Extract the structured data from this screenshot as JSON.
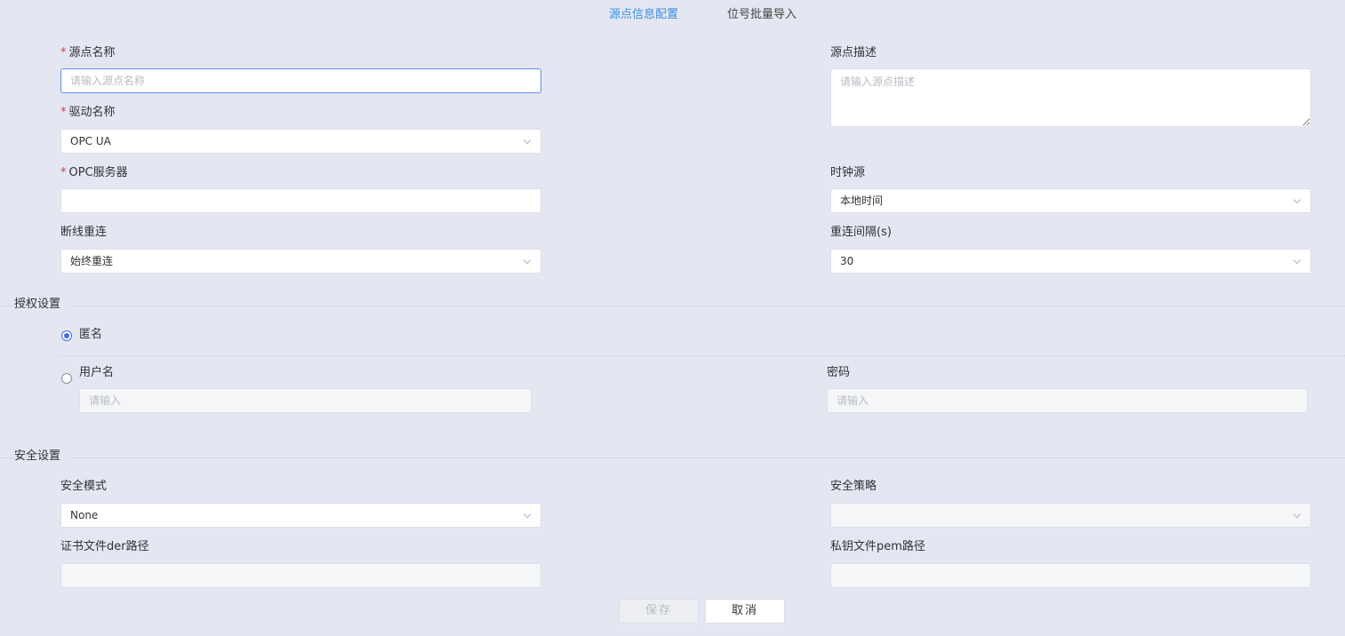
{
  "tabs": [
    {
      "label": "源点信息配置",
      "active": true
    },
    {
      "label": "位号批量导入",
      "active": false
    }
  ],
  "form": {
    "source_name": {
      "label": "源点名称",
      "required": true,
      "placeholder": "请输入源点名称",
      "value": ""
    },
    "source_desc": {
      "label": "源点描述",
      "placeholder": "请输入源点描述",
      "value": ""
    },
    "driver_name": {
      "label": "驱动名称",
      "required": true,
      "value": "OPC UA"
    },
    "opc_server": {
      "label": "OPC服务器",
      "required": true,
      "value": ""
    },
    "clock_source": {
      "label": "时钟源",
      "value": "本地时间"
    },
    "reconnect": {
      "label": "断线重连",
      "value": "始终重连"
    },
    "reconnect_interval": {
      "label": "重连间隔(s)",
      "value": "30"
    }
  },
  "auth": {
    "title": "授权设置",
    "anonymous_label": "匿名",
    "anonymous_selected": true,
    "username_label": "用户名",
    "username_placeholder": "请输入",
    "password_label": "密码",
    "password_placeholder": "请输入"
  },
  "security": {
    "title": "安全设置",
    "mode_label": "安全模式",
    "mode_value": "None",
    "policy_label": "安全策略",
    "policy_value": "",
    "cert_label": "证书文件der路径",
    "key_label": "私钥文件pem路径"
  },
  "actions": {
    "save_label": "保存",
    "cancel_label": "取消"
  },
  "colors": {
    "accent": "#3a8ee6",
    "required": "#e53935",
    "background": "#e4e7f1"
  }
}
